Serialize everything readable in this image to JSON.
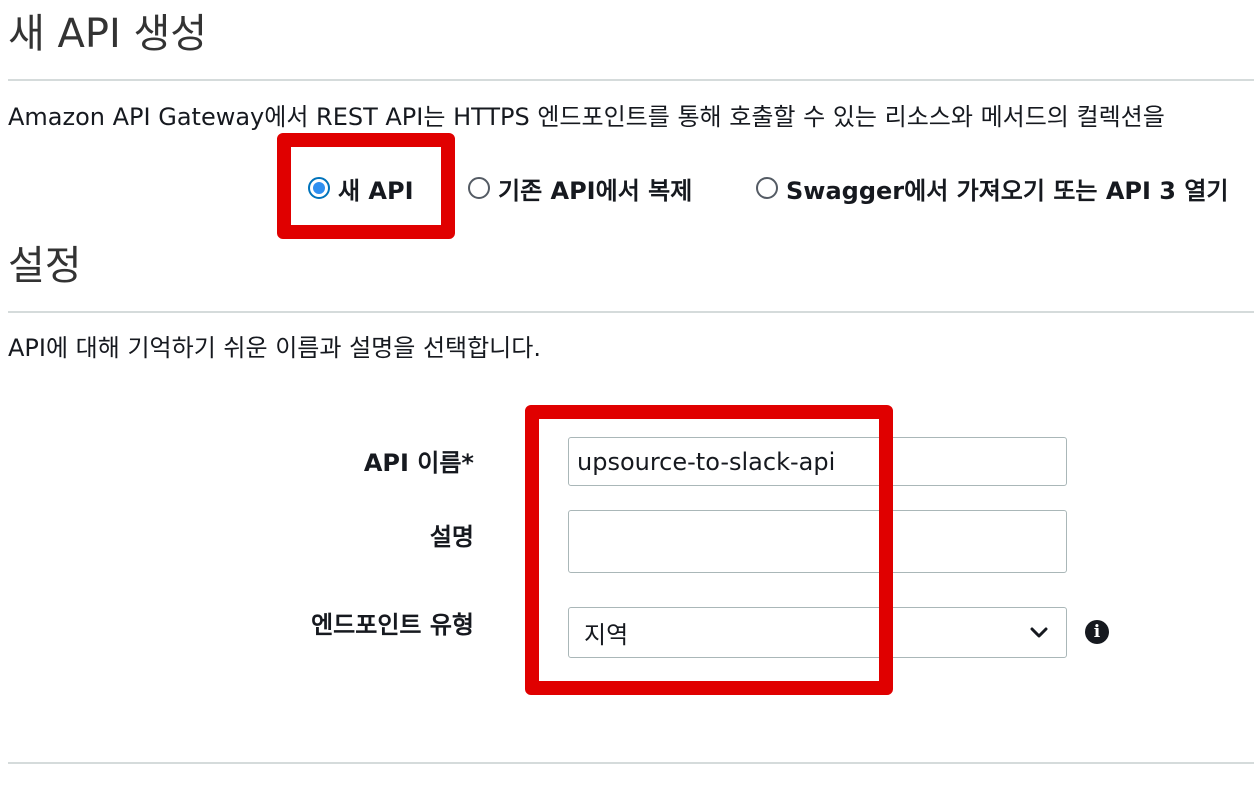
{
  "header": {
    "title": "새 API 생성",
    "intro": "Amazon API Gateway에서 REST API는 HTTPS 엔드포인트를 통해 호출할 수 있는 리소스와 메서드의 컬렉션을"
  },
  "api_type": {
    "options": [
      {
        "label": "새 API",
        "checked": true
      },
      {
        "label": "기존 API에서 복제",
        "checked": false
      },
      {
        "label": "Swagger에서 가져오기 또는 API 3 열기",
        "checked": false
      }
    ]
  },
  "settings": {
    "title": "설정",
    "description": "API에 대해 기억하기 쉬운 이름과 설명을 선택합니다.",
    "api_name_label": "API 이름*",
    "api_name_value": "upsource-to-slack-api",
    "description_label": "설명",
    "description_value": "",
    "endpoint_type_label": "엔드포인트 유형",
    "endpoint_type_value": "지역"
  },
  "icons": {
    "chevron": "chevron-down-icon",
    "info": "info-icon"
  },
  "colors": {
    "highlight": "#e00000",
    "radio_selected": "#2f8ff0"
  }
}
